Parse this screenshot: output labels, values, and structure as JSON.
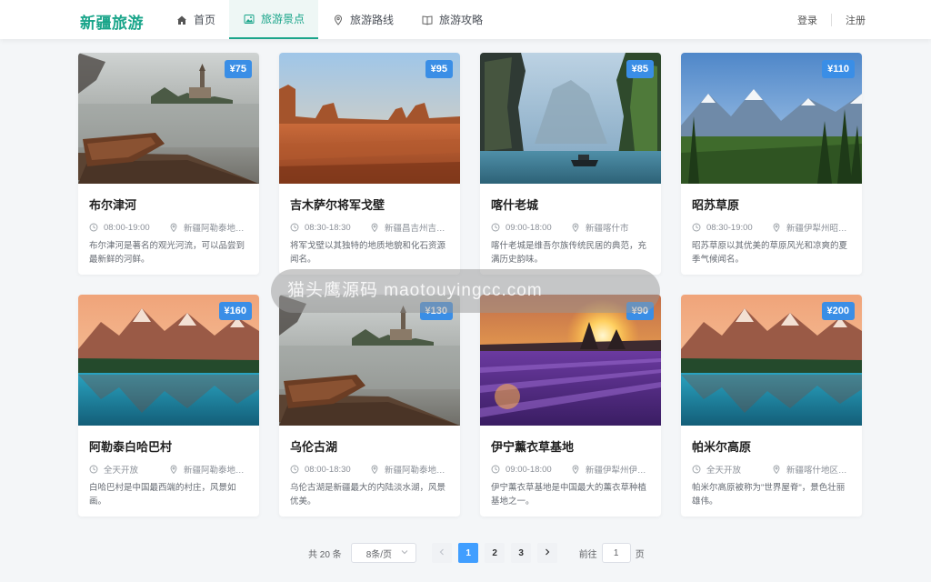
{
  "header": {
    "logo": "新疆旅游",
    "nav": [
      {
        "label": "首页",
        "icon": "home-icon"
      },
      {
        "label": "旅游景点",
        "icon": "image-icon",
        "active": true
      },
      {
        "label": "旅游路线",
        "icon": "location-pin-icon"
      },
      {
        "label": "旅游攻略",
        "icon": "book-icon"
      }
    ],
    "login": "登录",
    "register": "注册"
  },
  "cards": [
    {
      "price": "¥75",
      "title": "布尔津河",
      "time": "08:00-19:00",
      "location": "新疆阿勒泰地…",
      "desc": "布尔津河是著名的观光河流，可以品尝到最新鲜的河鲜。",
      "scene": "lake-boat"
    },
    {
      "price": "¥95",
      "title": "吉木萨尔将军戈壁",
      "time": "08:30-18:30",
      "location": "新疆昌吉州吉…",
      "desc": "将军戈壁以其独特的地质地貌和化石资源闻名。",
      "scene": "desert"
    },
    {
      "price": "¥85",
      "title": "喀什老城",
      "time": "09:00-18:00",
      "location": "新疆喀什市",
      "desc": "喀什老城是维吾尔族传统民居的典范，充满历史韵味。",
      "scene": "cliff-lake"
    },
    {
      "price": "¥110",
      "title": "昭苏草原",
      "time": "08:30-19:00",
      "location": "新疆伊犁州昭…",
      "desc": "昭苏草原以其优美的草原风光和凉爽的夏季气候闻名。",
      "scene": "mountain-forest"
    },
    {
      "price": "¥160",
      "title": "阿勒泰白哈巴村",
      "time": "全天开放",
      "location": "新疆阿勒泰地…",
      "desc": "白哈巴村是中国最西端的村庄，风景如画。",
      "scene": "turquoise-lake"
    },
    {
      "price": "¥130",
      "title": "乌伦古湖",
      "time": "08:00-18:30",
      "location": "新疆阿勒泰地…",
      "desc": "乌伦古湖是新疆最大的内陆淡水湖，风景优美。",
      "scene": "lake-boat"
    },
    {
      "price": "¥90",
      "title": "伊宁薰衣草基地",
      "time": "09:00-18:00",
      "location": "新疆伊犁州伊…",
      "desc": "伊宁薰衣草基地是中国最大的薰衣草种植基地之一。",
      "scene": "lavender"
    },
    {
      "price": "¥200",
      "title": "帕米尔高原",
      "time": "全天开放",
      "location": "新疆喀什地区…",
      "desc": "帕米尔高原被称为\"世界屋脊\"，景色壮丽雄伟。",
      "scene": "turquoise-lake"
    }
  ],
  "watermark": "猫头鹰源码 maotouyingcc.com",
  "pagination": {
    "total": "共 20 条",
    "page_size": "8条/页",
    "pages": [
      "1",
      "2",
      "3"
    ],
    "current": "1",
    "goto_label": "前往",
    "goto_value": "1",
    "page_unit": "页"
  },
  "colors": {
    "brand": "#1aa58a",
    "price_badge": "#3a8ee6",
    "active_page": "#409eff"
  }
}
